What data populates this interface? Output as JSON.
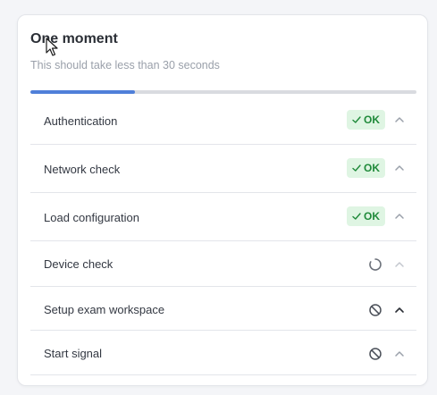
{
  "card": {
    "title": "One moment",
    "subtitle": "This should take less than 30 seconds"
  },
  "progress": {
    "fraction": 0.27,
    "fill_color": "#4f7fd9",
    "track_color": "#d9dbe0"
  },
  "colors": {
    "ok_badge_bg": "#dff5e3",
    "ok_badge_text": "#1f8a3a"
  },
  "steps": [
    {
      "label": "Authentication",
      "status": "ok",
      "status_text": "OK",
      "icon": "check-icon",
      "chevron": "chevron-up-icon"
    },
    {
      "label": "Network check",
      "status": "ok",
      "status_text": "OK",
      "icon": "check-icon",
      "chevron": "chevron-up-icon"
    },
    {
      "label": "Load configuration",
      "status": "ok",
      "status_text": "OK",
      "icon": "check-icon",
      "chevron": "chevron-up-icon"
    },
    {
      "label": "Device check",
      "status": "loading",
      "icon": "spinner-icon",
      "chevron": "chevron-up-icon"
    },
    {
      "label": "Setup exam workspace",
      "status": "blocked",
      "icon": "blocked-icon",
      "chevron": "chevron-up-icon"
    },
    {
      "label": "Start signal",
      "status": "blocked",
      "icon": "blocked-icon",
      "chevron": "chevron-up-icon"
    }
  ]
}
